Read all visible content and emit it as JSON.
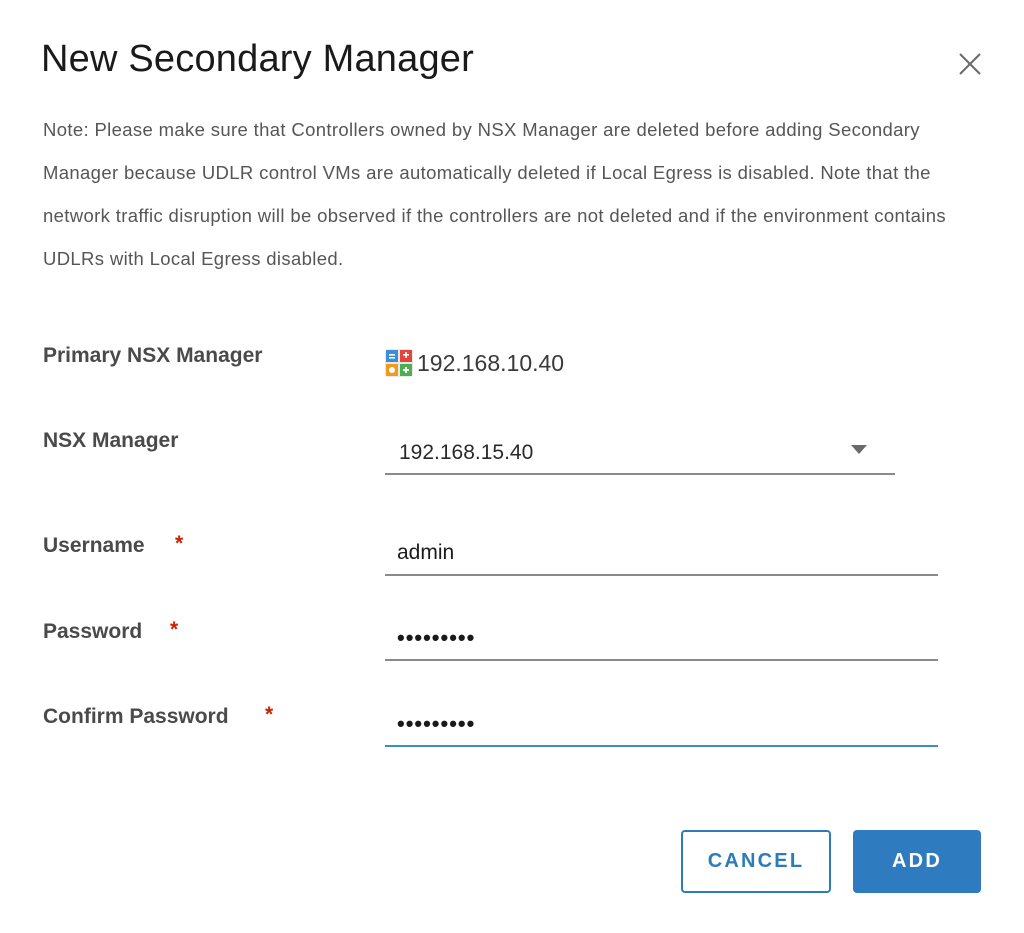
{
  "dialog": {
    "title": "New Secondary Manager",
    "close_icon": "close-icon",
    "note": "Note: Please make sure that Controllers owned by NSX Manager are deleted before adding Secondary Manager because UDLR control VMs are automatically deleted if Local Egress is disabled. Note that the network traffic disruption will be observed if the controllers are not deleted and if the environment contains UDLRs with Local Egress disabled."
  },
  "form": {
    "primary": {
      "label": "Primary NSX Manager",
      "icon": "nsx-manager-icon",
      "value": "192.168.10.40"
    },
    "manager": {
      "label": "NSX Manager",
      "selected": "192.168.15.40",
      "caret_icon": "caret-down-icon"
    },
    "username": {
      "label": "Username",
      "required_mark": "*",
      "value": "admin"
    },
    "password": {
      "label": "Password",
      "required_mark": "*",
      "value": "•••••••••"
    },
    "confirm_password": {
      "label": "Confirm Password",
      "required_mark": "*",
      "value": "•••••••••"
    }
  },
  "buttons": {
    "cancel": "CANCEL",
    "add": "ADD"
  },
  "colors": {
    "primary_button": "#2f7bbf",
    "outline_button": "#2d7cba",
    "required": "#c92100",
    "focus_underline": "#3a8ccf"
  }
}
